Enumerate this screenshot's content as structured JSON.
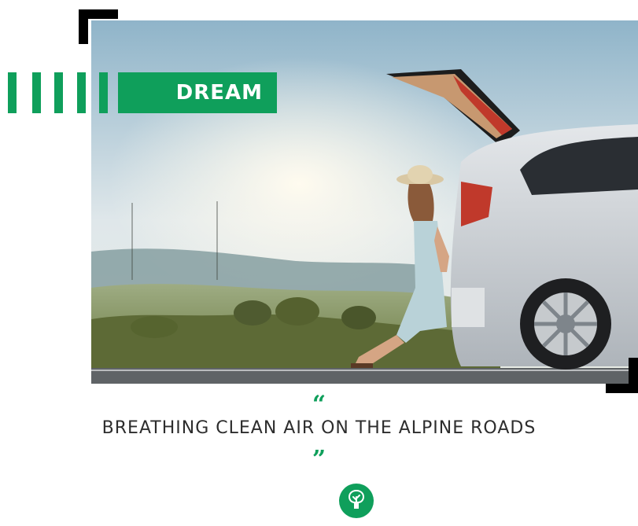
{
  "tag": {
    "label": "DREAM"
  },
  "quote": {
    "open_mark": "“",
    "text": "BREATHING CLEAN AIR ON THE ALPINE ROADS",
    "close_mark": "”"
  },
  "icons": {
    "badge": "tree-icon"
  },
  "colors": {
    "accent": "#0f9f5b",
    "frame": "#000000",
    "text": "#2d2d2d"
  }
}
